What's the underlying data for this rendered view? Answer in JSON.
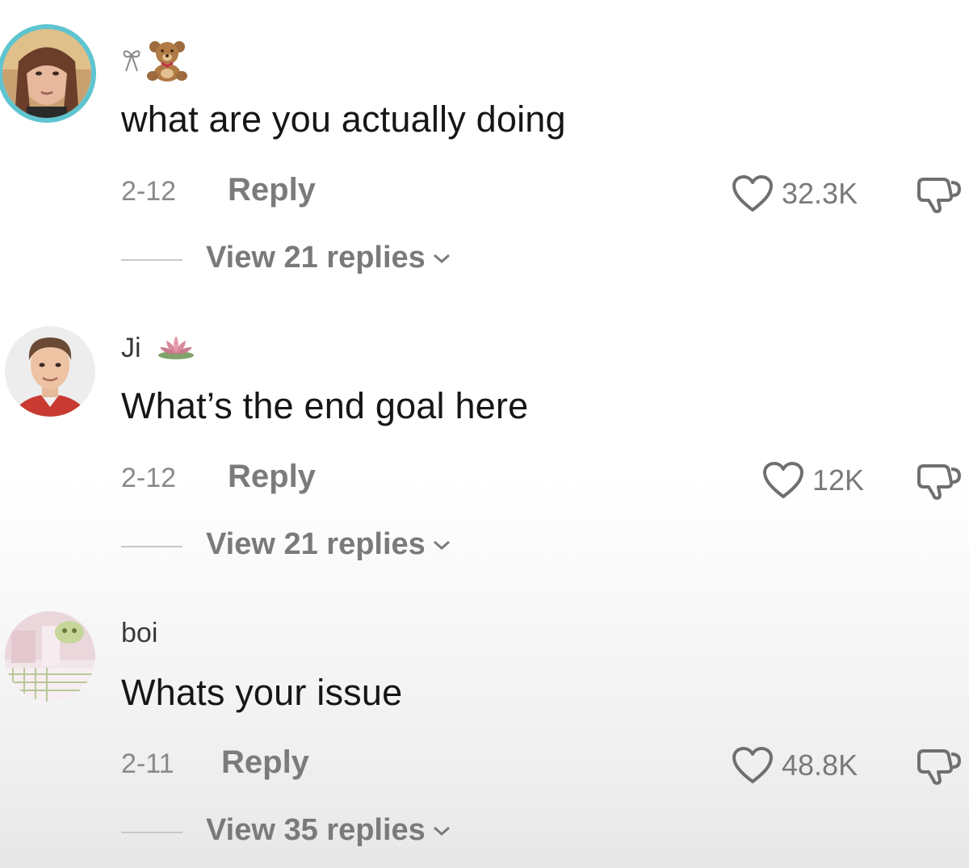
{
  "comments": [
    {
      "username": "",
      "text": "what are you actually doing",
      "date": "2-12",
      "reply_label": "Reply",
      "likes": "32.3K",
      "view_replies": "View 21 replies",
      "name_emojis": [
        "ribbon-icon",
        "teddy-bear-icon"
      ],
      "has_story_ring": true
    },
    {
      "username": "Ji",
      "text": "What’s the end goal here",
      "date": "2-12",
      "reply_label": "Reply",
      "likes": "12K",
      "view_replies": "View 21 replies",
      "name_emojis": [
        "lotus-icon"
      ],
      "has_story_ring": false
    },
    {
      "username": "boi",
      "text": "Whats your issue",
      "date": "2-11",
      "reply_label": "Reply",
      "likes": "48.8K",
      "view_replies": "View 35 replies",
      "name_emojis": [],
      "has_story_ring": false
    }
  ],
  "icons": {
    "like": "heart-outline-icon",
    "dislike": "thumbs-down-icon",
    "expand": "chevron-down-icon"
  },
  "colors": {
    "story_ring": "#5fc4d0",
    "secondary_text": "#8a8a8a",
    "primary_text": "#161616"
  }
}
